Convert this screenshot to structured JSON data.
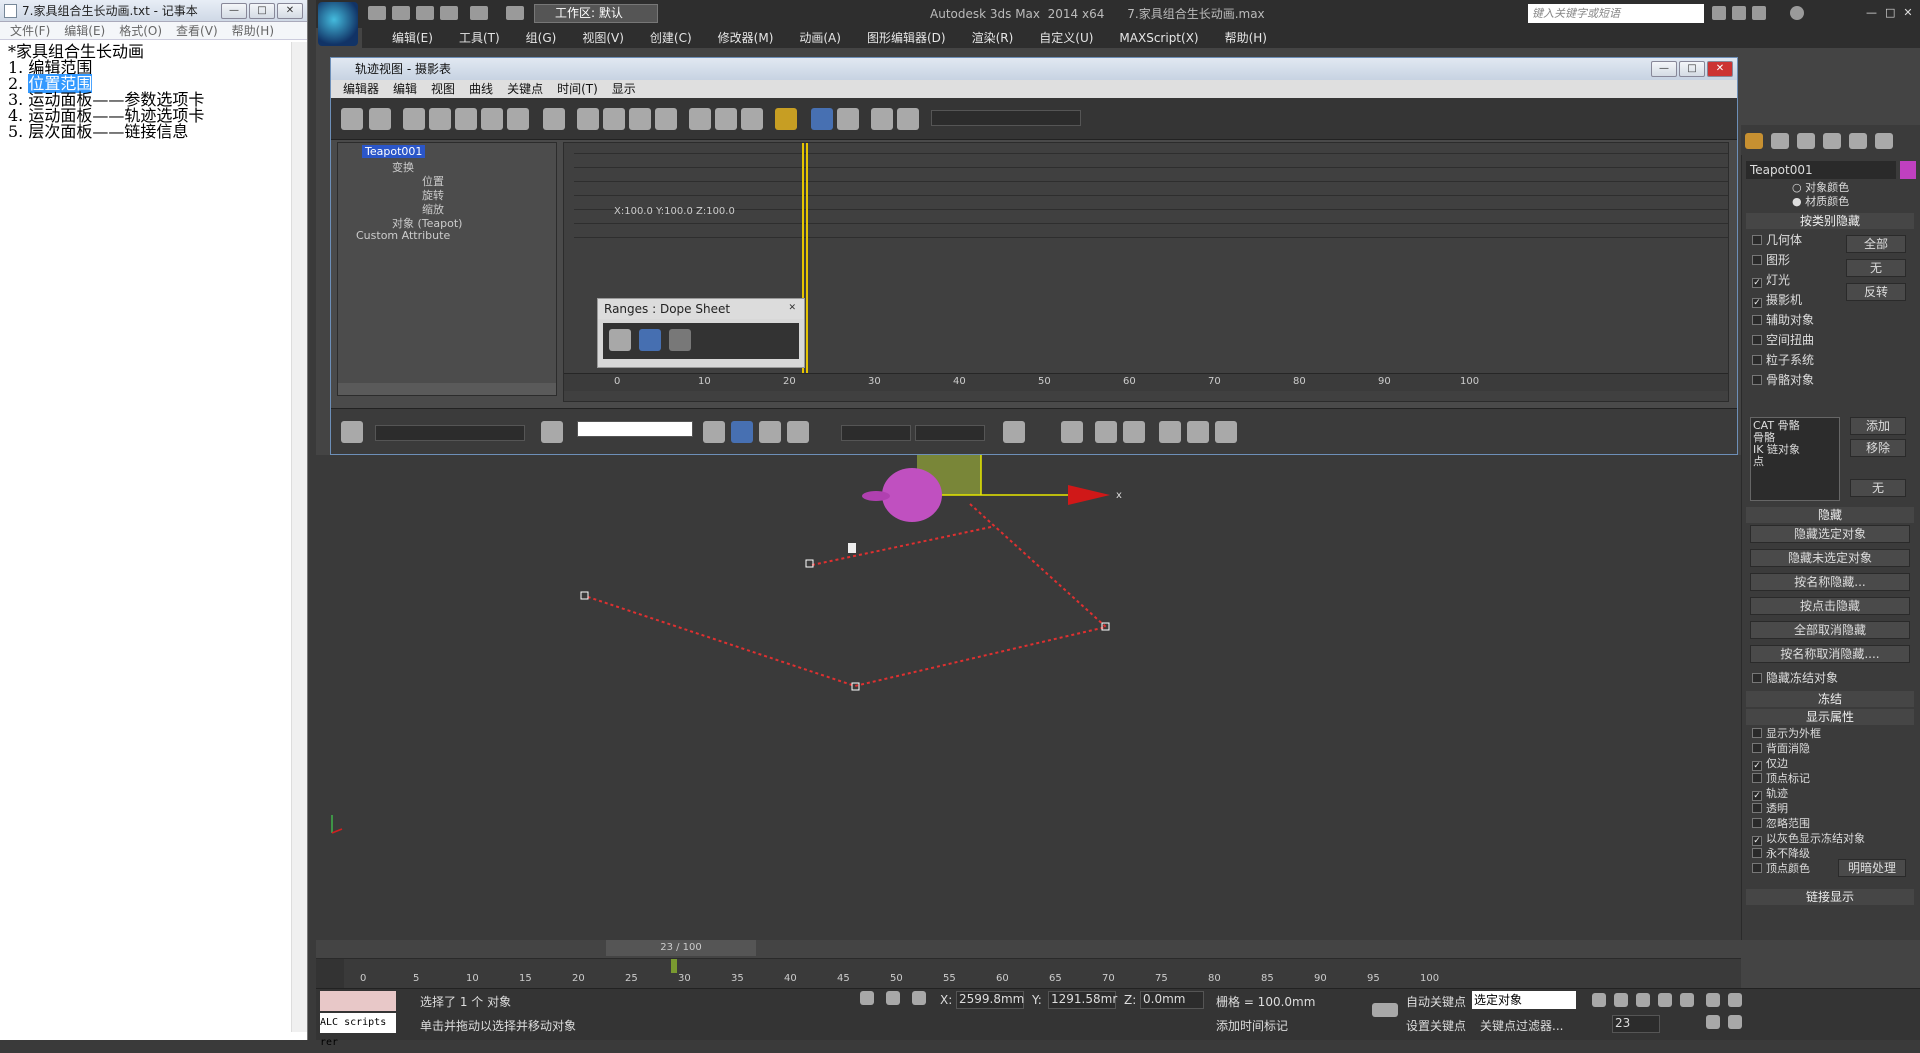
{
  "notepad": {
    "title": "7.家具组合生长动画.txt - 记事本",
    "window_buttons": [
      "—",
      "□",
      "✕"
    ],
    "menu": [
      "文件(F)",
      "编辑(E)",
      "格式(O)",
      "查看(V)",
      "帮助(H)"
    ],
    "lines": [
      "*家具组合生长动画",
      "",
      "1. 编辑范围",
      "2. ",
      "3. 运动面板——参数选项卡",
      "4. 运动面板——轨迹选项卡",
      "5. 层次面板——链接信息"
    ],
    "line2_selected": "位置范围"
  },
  "max": {
    "title": "Autodesk 3ds Max  2014 x64      7.家具组合生长动画.max",
    "workspace": "工作区: 默认",
    "search_placeholder": "键入关键字或短语",
    "menu": [
      "编辑(E)",
      "工具(T)",
      "组(G)",
      "视图(V)",
      "创建(C)",
      "修改器(M)",
      "动画(A)",
      "图形编辑器(D)",
      "渲染(R)",
      "自定义(U)",
      "MAXScript(X)",
      "帮助(H)"
    ],
    "window_buttons": [
      "—",
      "□",
      "✕"
    ]
  },
  "trackview": {
    "title": "轨迹视图 - 摄影表",
    "menu": [
      "编辑器",
      "编辑",
      "视图",
      "曲线",
      "关键点",
      "时间(T)",
      "显示"
    ],
    "tree": {
      "object": "Teapot001",
      "items": [
        "变换",
        "位置",
        "旋转",
        "缩放",
        "对象 (Teapot)"
      ],
      "custom": "Custom Attribute"
    },
    "sheet_label": "X:100.0 Y:100.0 Z:100.0",
    "ruler": [
      0,
      10,
      20,
      30,
      40,
      50,
      60,
      70,
      80,
      90,
      100
    ],
    "ranges_title": "Ranges : Dope Sheet",
    "close": "✕"
  },
  "viewport": {
    "axis_label": "x"
  },
  "command_panel": {
    "object_name": "Teapot001",
    "color_options": [
      "对象颜色",
      "材质颜色"
    ],
    "hide_by_category_title": "按类别隐藏",
    "categories": [
      {
        "label": "几何体",
        "checked": false
      },
      {
        "label": "图形",
        "checked": false
      },
      {
        "label": "灯光",
        "checked": true
      },
      {
        "label": "摄影机",
        "checked": true
      },
      {
        "label": "辅助对象",
        "checked": false
      },
      {
        "label": "空间扭曲",
        "checked": false
      },
      {
        "label": "粒子系统",
        "checked": false
      },
      {
        "label": "骨骼对象",
        "checked": false
      }
    ],
    "cat_buttons": [
      "全部",
      "无",
      "反转"
    ],
    "list_items": [
      "CAT 骨骼",
      "骨骼",
      "IK 链对象",
      "点"
    ],
    "list_buttons": [
      "添加",
      "移除",
      "无"
    ],
    "hide_title": "隐藏",
    "hide_buttons": [
      "隐藏选定对象",
      "隐藏未选定对象",
      "按名称隐藏...",
      "按点击隐藏",
      "全部取消隐藏",
      "按名称取消隐藏...."
    ],
    "hide_frozen": "隐藏冻结对象",
    "freeze_title": "冻结",
    "display_props_title": "显示属性",
    "display_props": [
      {
        "label": "显示为外框",
        "checked": false
      },
      {
        "label": "背面消隐",
        "checked": false
      },
      {
        "label": "仅边",
        "checked": true
      },
      {
        "label": "顶点标记",
        "checked": false
      },
      {
        "label": "轨迹",
        "checked": true
      },
      {
        "label": "透明",
        "checked": false
      },
      {
        "label": "忽略范围",
        "checked": false
      },
      {
        "label": "以灰色显示冻结对象",
        "checked": true
      },
      {
        "label": "永不降级",
        "checked": false
      },
      {
        "label": "顶点颜色",
        "checked": false
      }
    ],
    "shading_button": "明暗处理",
    "link_display_title": "链接显示"
  },
  "timeline": {
    "slider": "23 / 100",
    "ticks": [
      0,
      5,
      10,
      15,
      20,
      25,
      30,
      35,
      40,
      45,
      50,
      55,
      60,
      65,
      70,
      75,
      80,
      85,
      90,
      95,
      100
    ]
  },
  "status": {
    "maxscript": "ALC scripts rer",
    "selected": "选择了 1 个 对象",
    "prompt": "单击并拖动以选择并移动对象",
    "x_label": "X:",
    "x": "2599.8mm",
    "y_label": "Y:",
    "y": "1291.58mr",
    "z_label": "Z:",
    "z": "0.0mm",
    "grid": "栅格 = 100.0mm",
    "add_time_tag": "添加时间标记",
    "auto_key": "自动关键点",
    "set_key": "设置关键点",
    "selection_set": "选定对象",
    "key_filters": "关键点过滤器...",
    "frame": "23"
  }
}
